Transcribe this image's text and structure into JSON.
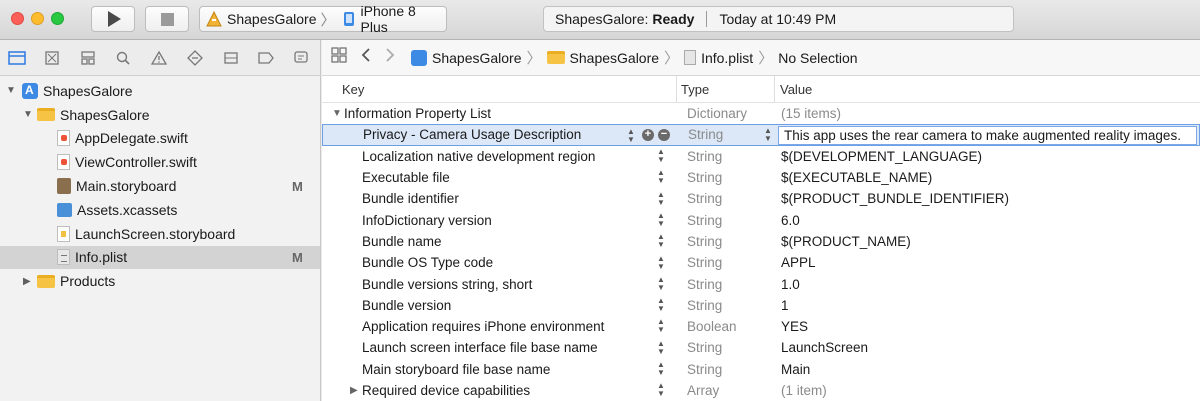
{
  "toolbar": {
    "scheme_name": "ShapesGalore",
    "device_name": "iPhone 8 Plus",
    "status_project": "ShapesGalore:",
    "status_state": "Ready",
    "status_time": "Today at 10:49 PM"
  },
  "navigator": {
    "tabs": [
      "project-navigator-icon",
      "source-control-icon",
      "symbol-navigator-icon",
      "find-navigator-icon",
      "issue-navigator-icon",
      "test-navigator-icon",
      "debug-navigator-icon",
      "breakpoint-navigator-icon",
      "report-navigator-icon"
    ],
    "items": [
      {
        "label": "ShapesGalore",
        "badge": ""
      },
      {
        "label": "ShapesGalore",
        "badge": ""
      },
      {
        "label": "AppDelegate.swift",
        "badge": ""
      },
      {
        "label": "ViewController.swift",
        "badge": ""
      },
      {
        "label": "Main.storyboard",
        "badge": "M"
      },
      {
        "label": "Assets.xcassets",
        "badge": ""
      },
      {
        "label": "LaunchScreen.storyboard",
        "badge": ""
      },
      {
        "label": "Info.plist",
        "badge": "M"
      },
      {
        "label": "Products",
        "badge": ""
      }
    ]
  },
  "jumpbar": {
    "crumbs": [
      "ShapesGalore",
      "ShapesGalore",
      "Info.plist",
      "No Selection"
    ]
  },
  "plist": {
    "headers": {
      "key": "Key",
      "type": "Type",
      "value": "Value"
    },
    "rows": [
      {
        "key": "Information Property List",
        "type": "Dictionary",
        "value": "(15 items)"
      },
      {
        "key": "Privacy - Camera Usage Description",
        "type": "String",
        "value": "This app uses the rear camera to make augmented reality images."
      },
      {
        "key": "Localization native development region",
        "type": "String",
        "value": "$(DEVELOPMENT_LANGUAGE)"
      },
      {
        "key": "Executable file",
        "type": "String",
        "value": "$(EXECUTABLE_NAME)"
      },
      {
        "key": "Bundle identifier",
        "type": "String",
        "value": "$(PRODUCT_BUNDLE_IDENTIFIER)"
      },
      {
        "key": "InfoDictionary version",
        "type": "String",
        "value": "6.0"
      },
      {
        "key": "Bundle name",
        "type": "String",
        "value": "$(PRODUCT_NAME)"
      },
      {
        "key": "Bundle OS Type code",
        "type": "String",
        "value": "APPL"
      },
      {
        "key": "Bundle versions string, short",
        "type": "String",
        "value": "1.0"
      },
      {
        "key": "Bundle version",
        "type": "String",
        "value": "1"
      },
      {
        "key": "Application requires iPhone environment",
        "type": "Boolean",
        "value": "YES"
      },
      {
        "key": "Launch screen interface file base name",
        "type": "String",
        "value": "LaunchScreen"
      },
      {
        "key": "Main storyboard file base name",
        "type": "String",
        "value": "Main"
      },
      {
        "key": "Required device capabilities",
        "type": "Array",
        "value": "(1 item)"
      }
    ]
  }
}
